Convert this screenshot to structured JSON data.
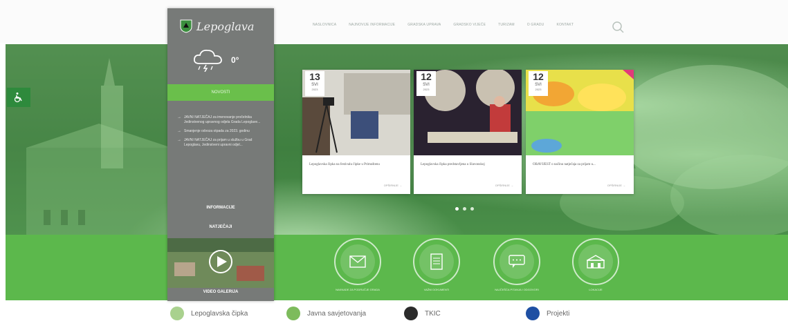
{
  "brand": {
    "name": "Lepoglava"
  },
  "nav": {
    "items": [
      "NASLOVNICA",
      "NAJNOVIJE INFORMACIJE",
      "GRADSKA UPRAVA",
      "GRADSKO VIJEĆE",
      "TURIZAM",
      "O GRADU",
      "KONTAKT"
    ]
  },
  "weather": {
    "temperature": "0°",
    "icon": "thunder-cloud-icon"
  },
  "sidebar": {
    "news_button": "NOVOSTI",
    "news": [
      "JAVNI NATJEČAJ za imenovanje pročelnika Jedinstvenog upravnog odjela Grada Lepoglave...",
      "Smanjenje odvoza otpada za 2023. godinu",
      "JAVNI NATJEČAJ za prijam u službu u Grad Lepoglavu, Jedinstveni upravni odjel..."
    ],
    "links": [
      "INFORMACIJE",
      "NATJEČAJI"
    ],
    "video_label": "VIDEO GALERIJA"
  },
  "cards": [
    {
      "day": "13",
      "month": "SVI",
      "year": "2023",
      "caption": "Lepoglavska čipka na festivalu čipke u Primoštenu",
      "more": "OPŠIRNIJE →"
    },
    {
      "day": "12",
      "month": "SVI",
      "year": "2023",
      "caption": "Lepoglavska čipka predstavljena u Slavonskoj",
      "more": "OPŠIRNIJE →"
    },
    {
      "day": "12",
      "month": "SVI",
      "year": "2023",
      "caption": "OBAVIJEST o načinu natječaja za prijam u...",
      "more": "OPŠIRNIJE →"
    }
  ],
  "services": [
    {
      "label": "NAKNADE ZA PODRUČJE GRADA",
      "icon": "envelope-icon"
    },
    {
      "label": "VAŽNI DOKUMENTI",
      "icon": "document-icon"
    },
    {
      "label": "NAJČEŠĆA PITANJA I ODGOVORI",
      "icon": "chat-icon"
    },
    {
      "label": "LOKACIJE",
      "icon": "buildings-icon"
    }
  ],
  "bottom_links": [
    {
      "label": "Lepoglavska čipka",
      "color": "#a9d18e"
    },
    {
      "label": "Javna savjetovanja",
      "color": "#7dbb5c"
    },
    {
      "label": "TKIC",
      "color": "#2b2b2b"
    },
    {
      "label": "Projekti",
      "color": "#1e4fa3"
    }
  ],
  "colors": {
    "accent": "#5cb84c",
    "sidebar": "#777a78"
  }
}
